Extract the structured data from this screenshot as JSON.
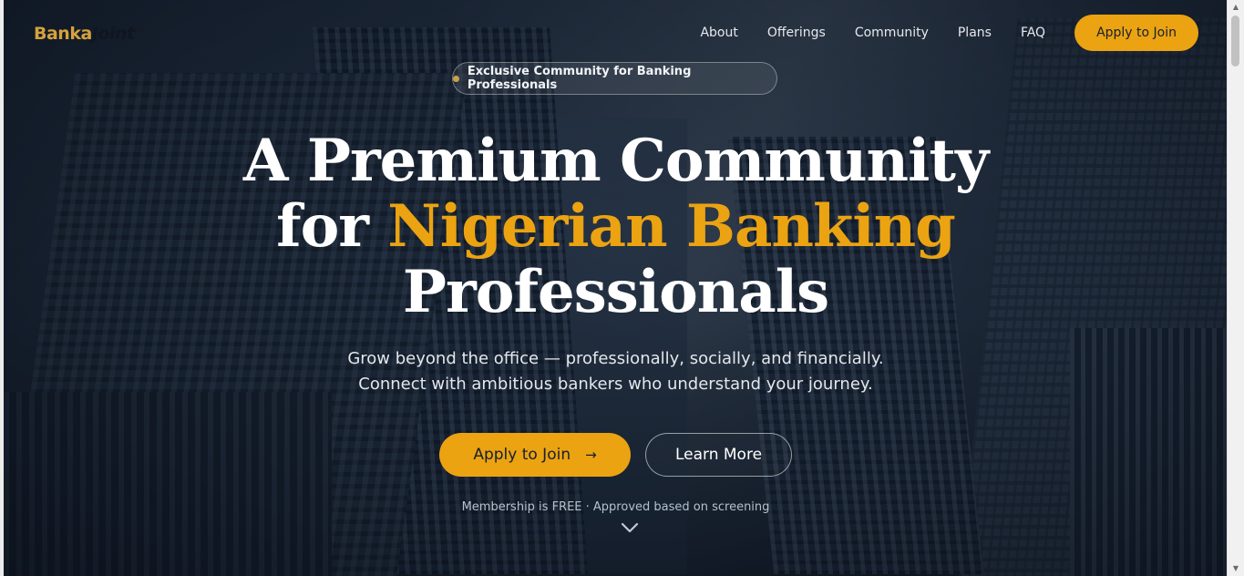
{
  "brand": {
    "part1": "Banka",
    "part2": "Joint"
  },
  "nav": {
    "links": [
      "About",
      "Offerings",
      "Community",
      "Plans",
      "FAQ"
    ],
    "cta": "Apply to Join"
  },
  "hero": {
    "badge": "Exclusive Community for Banking Professionals",
    "headline_line1": "A Premium Community",
    "headline_for": "for ",
    "headline_highlight": "Nigerian Banking",
    "headline_line3": "Professionals",
    "subtitle_line1": "Grow beyond the office — professionally, socially, and financially.",
    "subtitle_line2": "Connect with ambitious bankers who understand your journey.",
    "primary_button": "Apply to Join",
    "primary_arrow": "→",
    "secondary_button": "Learn More",
    "note": "Membership is FREE · Approved based on screening"
  },
  "colors": {
    "accent": "#eba312",
    "brand_gold": "#d4a23c",
    "background_dark": "#1b2533"
  },
  "icons": [
    "arrow-right-icon",
    "chevron-down-icon",
    "badge-dot-icon",
    "scroll-up-arrow-icon",
    "scroll-down-arrow-icon"
  ]
}
